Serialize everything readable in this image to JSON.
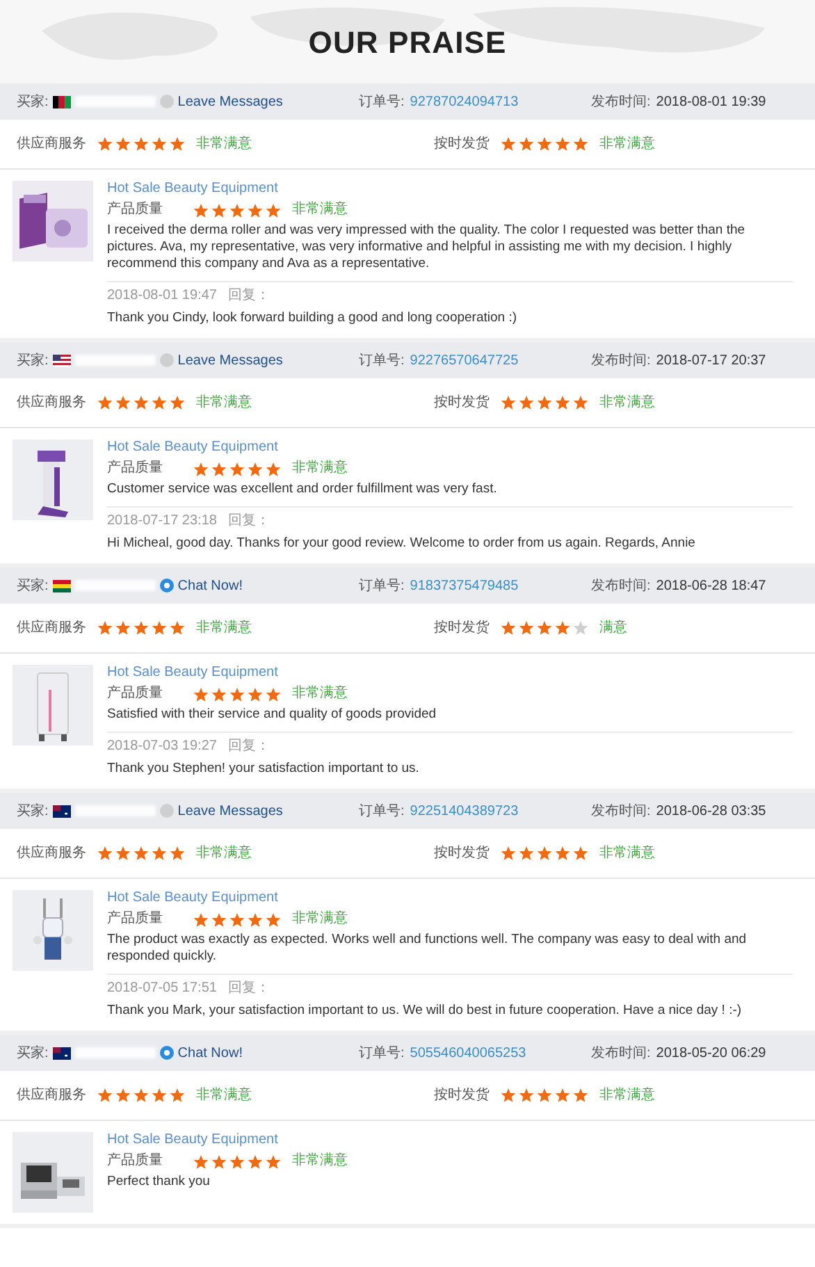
{
  "title": "OUR PRAISE",
  "reviews": [
    {
      "buyer_label": "买家:",
      "flag": {
        "kind": "afghanistan"
      },
      "contact": {
        "kind": "message",
        "label": "Leave Messages"
      },
      "order_label": "订单号:",
      "order_no": "92787024094713",
      "time_label": "发布时间:",
      "time": "2018-08-01 19:39",
      "ratings": [
        {
          "label": "供应商服务",
          "stars": 5,
          "verdict": "非常满意"
        },
        {
          "label": "按时发货",
          "stars": 5,
          "verdict": "非常满意"
        }
      ],
      "product": {
        "kind": "box",
        "title": "Hot Sale Beauty Equipment",
        "quality_label": "产品质量",
        "stars": 5,
        "verdict": "非常满意"
      },
      "text": "I received the derma roller and was very impressed with the quality. The color I requested was better than the pictures. Ava, my representative, was very informative and helpful in assisting me with my decision. I highly recommend this company and Ava as a representative.",
      "reply_time": "2018-08-01 19:47",
      "reply_label": "回复：",
      "reply": "Thank you Cindy, look forward building a good and long cooperation :)"
    },
    {
      "buyer_label": "买家:",
      "flag": {
        "kind": "usa"
      },
      "contact": {
        "kind": "message",
        "label": "Leave Messages"
      },
      "order_label": "订单号:",
      "order_no": "92276570647725",
      "time_label": "发布时间:",
      "time": "2018-07-17 20:37",
      "ratings": [
        {
          "label": "供应商服务",
          "stars": 5,
          "verdict": "非常满意"
        },
        {
          "label": "按时发货",
          "stars": 5,
          "verdict": "非常满意"
        }
      ],
      "product": {
        "kind": "stand",
        "title": "Hot Sale Beauty Equipment",
        "quality_label": "产品质量",
        "stars": 5,
        "verdict": "非常满意"
      },
      "text": "Customer service was excellent and order fulfillment was very fast.",
      "reply_time": "2018-07-17 23:18",
      "reply_label": "回复：",
      "reply": "Hi Micheal, good day. Thanks for your good review. Welcome to order from us again. Regards, Annie"
    },
    {
      "buyer_label": "买家:",
      "flag": {
        "kind": "ghana"
      },
      "contact": {
        "kind": "chat",
        "label": "Chat Now!"
      },
      "order_label": "订单号:",
      "order_no": "91837375479485",
      "time_label": "发布时间:",
      "time": "2018-06-28 18:47",
      "ratings": [
        {
          "label": "供应商服务",
          "stars": 5,
          "verdict": "非常满意"
        },
        {
          "label": "按时发货",
          "stars": 4,
          "verdict": "满意"
        }
      ],
      "product": {
        "kind": "cabinet",
        "title": "Hot Sale Beauty Equipment",
        "quality_label": "产品质量",
        "stars": 5,
        "verdict": "非常满意"
      },
      "text": "Satisfied with their service and quality of goods provided",
      "reply_time": "2018-07-03 19:27",
      "reply_label": "回复：",
      "reply": "Thank you Stephen! your satisfaction important to us."
    },
    {
      "buyer_label": "买家:",
      "flag": {
        "kind": "australia"
      },
      "contact": {
        "kind": "message",
        "label": "Leave Messages"
      },
      "order_label": "订单号:",
      "order_no": "92251404389723",
      "time_label": "发布时间:",
      "time": "2018-06-28 03:35",
      "ratings": [
        {
          "label": "供应商服务",
          "stars": 5,
          "verdict": "非常满意"
        },
        {
          "label": "按时发货",
          "stars": 5,
          "verdict": "非常满意"
        }
      ],
      "product": {
        "kind": "robot",
        "title": "Hot Sale Beauty Equipment",
        "quality_label": "产品质量",
        "stars": 5,
        "verdict": "非常满意"
      },
      "text": "The product was exactly as expected. Works well and functions well. The company was easy to deal with and responded quickly.",
      "reply_time": "2018-07-05 17:51",
      "reply_label": "回复：",
      "reply": "Thank you Mark, your satisfaction important to us. We will do best in future cooperation. Have a nice day ! :-)"
    },
    {
      "buyer_label": "买家:",
      "flag": {
        "kind": "australia"
      },
      "contact": {
        "kind": "chat",
        "label": "Chat Now!"
      },
      "order_label": "订单号:",
      "order_no": "505546040065253",
      "time_label": "发布时间:",
      "time": "2018-05-20 06:29",
      "ratings": [
        {
          "label": "供应商服务",
          "stars": 5,
          "verdict": "非常满意"
        },
        {
          "label": "按时发货",
          "stars": 5,
          "verdict": "非常满意"
        }
      ],
      "product": {
        "kind": "console",
        "title": "Hot Sale Beauty Equipment",
        "quality_label": "产品质量",
        "stars": 5,
        "verdict": "非常满意"
      },
      "text": "Perfect thank you"
    }
  ]
}
